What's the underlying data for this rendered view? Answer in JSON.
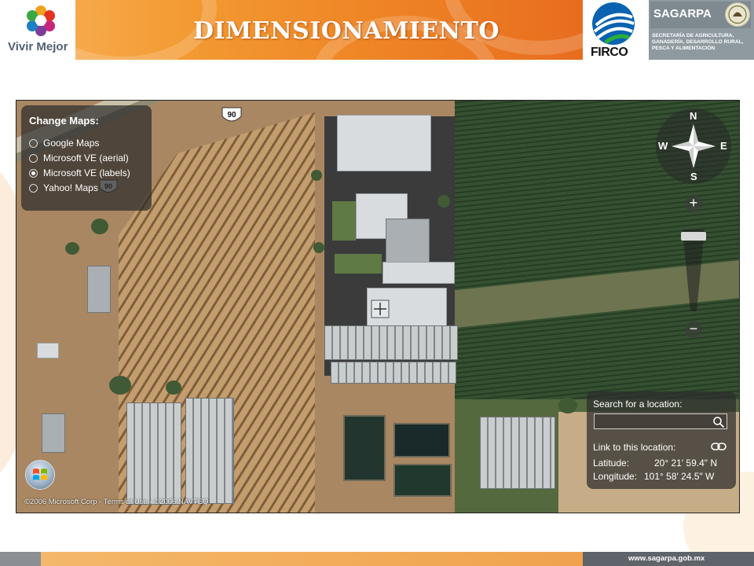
{
  "header": {
    "brand_left": "Vivir Mejor",
    "title": "DIMENSIONAMIENTO",
    "firco": "FIRCO",
    "sagarpa_name": "SAGARPA",
    "sagarpa_description": "SECRETARÍA DE AGRICULTURA, GANADERÍA, DESARROLLO RURAL, PESCA Y ALIMENTACIÓN"
  },
  "map": {
    "change_maps": {
      "title": "Change Maps:",
      "options": [
        {
          "label": "Google Maps",
          "selected": false
        },
        {
          "label": "Microsoft VE (aerial)",
          "selected": false
        },
        {
          "label": "Microsoft VE (labels)",
          "selected": true
        },
        {
          "label": "Yahoo! Maps",
          "selected": false
        }
      ]
    },
    "route_labels": [
      "90",
      "90"
    ],
    "compass": {
      "n": "N",
      "s": "S",
      "e": "E",
      "w": "W"
    },
    "zoom": {
      "in": "+",
      "out": "−",
      "level": 0.05
    },
    "search": {
      "label": "Search for a location:",
      "value": "",
      "placeholder": ""
    },
    "location": {
      "link_label": "Link to this location:",
      "latitude_label": "Latitude:",
      "latitude_value": "20° 21′ 59.4″ N",
      "longitude_label": "Longitude:",
      "longitude_value": "101° 58′ 24.5″ W"
    },
    "copyright": "©2006 Microsoft Corp - Terms of Use - ©2006 NAVTEQ"
  },
  "footer": {
    "url": "www.sagarpa.gob.mx"
  },
  "colors": {
    "title_band": "#ee8425",
    "sagarpa_grey": "#8e9aa0",
    "footer_orange": "#f0a24d"
  }
}
